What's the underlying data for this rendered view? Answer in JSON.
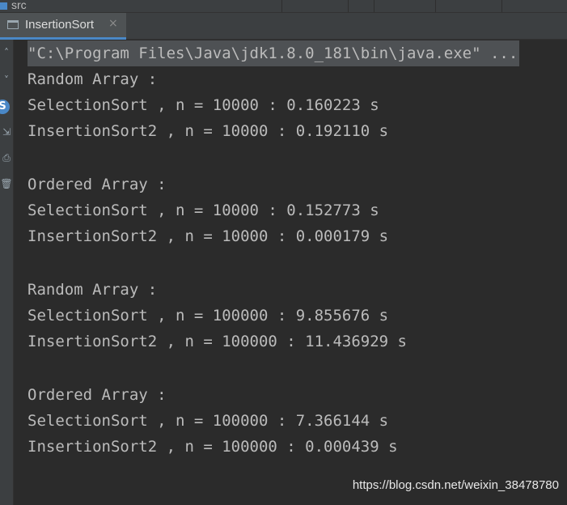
{
  "project": {
    "folder_label": "src",
    "folder_icon": "folder-icon"
  },
  "run_tab": {
    "label": "InsertionSort",
    "close_glyph": "×",
    "icon": "console-icon",
    "accent_color": "#4a88c7"
  },
  "gutter": {
    "icons": [
      "scroll-up-icon",
      "scroll-down-icon",
      "rerun-icon",
      "soft-wrap-icon",
      "print-icon",
      "delete-icon"
    ]
  },
  "console": {
    "command": "\"C:\\Program Files\\Java\\jdk1.8.0_181\\bin\\java.exe\" ...",
    "lines": [
      "Random Array :",
      "SelectionSort , n = 10000 : 0.160223 s",
      "InsertionSort2 , n = 10000 : 0.192110 s",
      "",
      "Ordered Array :",
      "SelectionSort , n = 10000 : 0.152773 s",
      "InsertionSort2 , n = 10000 : 0.000179 s",
      "",
      "Random Array :",
      "SelectionSort , n = 100000 : 9.855676 s",
      "InsertionSort2 , n = 100000 : 11.436929 s",
      "",
      "Ordered Array :",
      "SelectionSort , n = 100000 : 7.366144 s",
      "InsertionSort2 , n = 100000 : 0.000439 s"
    ]
  },
  "watermark": "https://blog.csdn.net/weixin_38478780"
}
